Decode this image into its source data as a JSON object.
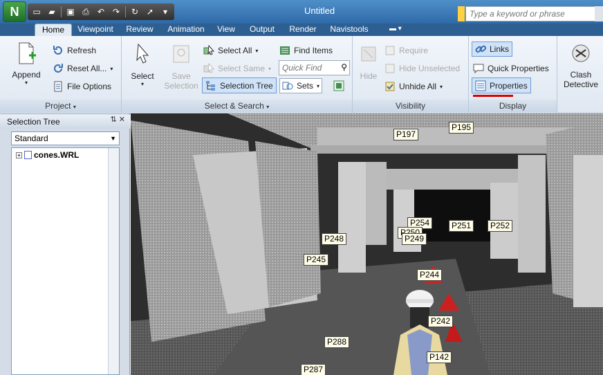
{
  "window": {
    "title": "Untitled"
  },
  "search": {
    "placeholder": "Type a keyword or phrase"
  },
  "tabs": [
    "Home",
    "Viewpoint",
    "Review",
    "Animation",
    "View",
    "Output",
    "Render",
    "Navistools"
  ],
  "project": {
    "label": "Project",
    "append": "Append",
    "refresh": "Refresh",
    "reset_all": "Reset All...",
    "file_options": "File Options"
  },
  "select_search": {
    "label": "Select & Search",
    "select": "Select",
    "save_selection_1": "Save",
    "save_selection_2": "Selection",
    "select_all": "Select All",
    "select_same": "Select Same",
    "selection_tree": "Selection Tree",
    "find_items": "Find Items",
    "quick_find_placeholder": "Quick Find",
    "sets": "Sets"
  },
  "visibility": {
    "label": "Visibility",
    "hide": "Hide",
    "require": "Require",
    "hide_unselected": "Hide Unselected",
    "unhide_all": "Unhide All"
  },
  "display": {
    "label": "Display",
    "links": "Links",
    "quick_properties": "Quick Properties",
    "properties": "Properties"
  },
  "clash": {
    "line1": "Clash",
    "line2": "Detective"
  },
  "selection_tree_panel": {
    "title": "Selection Tree",
    "dropdown_value": "Standard",
    "root_item": "cones.WRL"
  },
  "viewport_tags": [
    "P197",
    "P195",
    "P254",
    "P251",
    "P252",
    "P250",
    "P249",
    "P248",
    "P245",
    "P244",
    "P242",
    "P288",
    "P142",
    "P287"
  ]
}
